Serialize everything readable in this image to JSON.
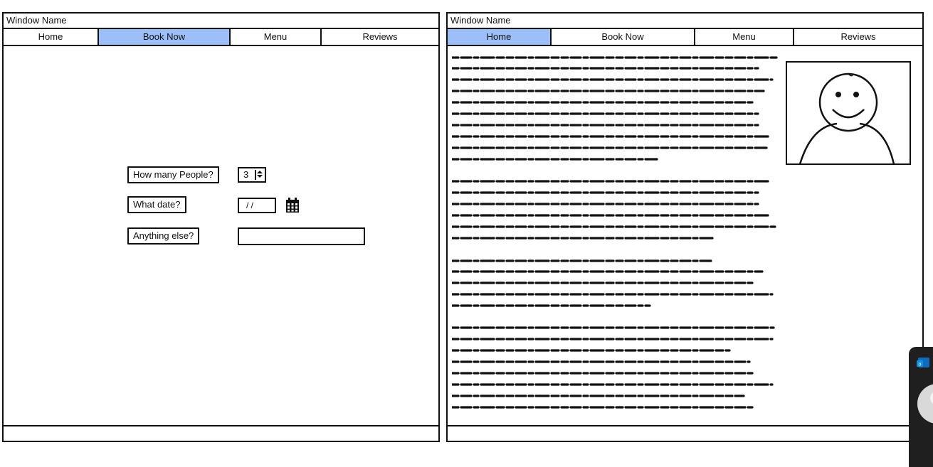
{
  "left_window": {
    "title": "Window Name",
    "tabs": [
      {
        "label": "Home",
        "active": false
      },
      {
        "label": "Book Now",
        "active": true
      },
      {
        "label": "Menu",
        "active": false
      },
      {
        "label": "Reviews",
        "active": false
      }
    ],
    "form": {
      "people_label": "How many People?",
      "people_value": "3",
      "date_label": "What date?",
      "date_value": "/ /",
      "else_label": "Anything else?",
      "else_value": ""
    }
  },
  "right_window": {
    "title": "Window Name",
    "tabs": [
      {
        "label": "Home",
        "active": true
      },
      {
        "label": "Book Now",
        "active": false
      },
      {
        "label": "Menu",
        "active": false
      },
      {
        "label": "Reviews",
        "active": false
      }
    ]
  },
  "colors": {
    "active_tab": "#9dbff9",
    "border": "#111111",
    "outlook_blue": "#0f6cbd"
  },
  "icons": [
    "calendar-icon",
    "stepper-arrows-icon",
    "user-portrait-icon",
    "outlook-icon",
    "avatar"
  ]
}
